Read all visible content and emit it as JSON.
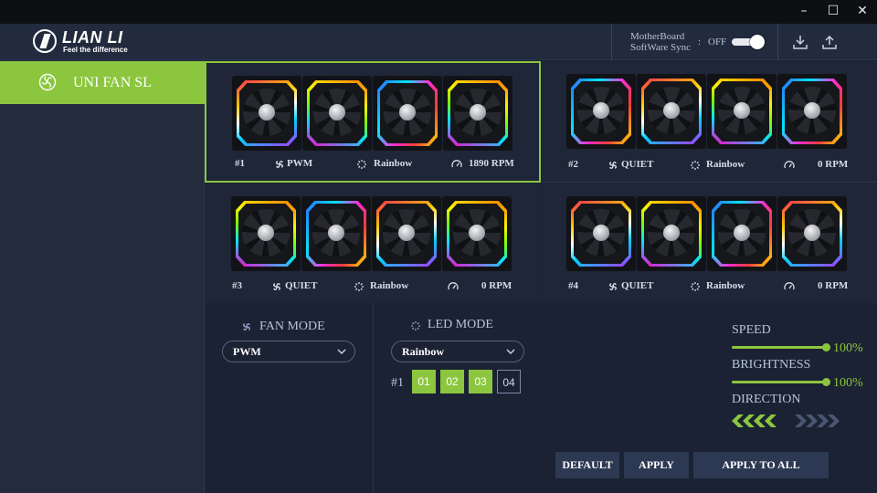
{
  "window": {
    "minimize": "–",
    "maximize": "☐",
    "close": "✕"
  },
  "header": {
    "brand_name": "LIAN LI",
    "brand_tagline": "Feel the difference",
    "sync_label": "MotherBoard SoftWare Sync",
    "sync_colon": ":",
    "sync_state": "OFF"
  },
  "sidebar": {
    "items": [
      {
        "label": "UNI FAN SL",
        "active": true
      }
    ]
  },
  "groups": [
    {
      "index": "#1",
      "fan_mode": "PWM",
      "led_mode": "Rainbow",
      "speed": "1890 RPM",
      "selected": true
    },
    {
      "index": "#2",
      "fan_mode": "QUIET",
      "led_mode": "Rainbow",
      "speed": "0 RPM",
      "selected": false
    },
    {
      "index": "#3",
      "fan_mode": "QUIET",
      "led_mode": "Rainbow",
      "speed": "0 RPM",
      "selected": false
    },
    {
      "index": "#4",
      "fan_mode": "QUIET",
      "led_mode": "Rainbow",
      "speed": "0 RPM",
      "selected": false
    }
  ],
  "fan_mode": {
    "title": "FAN MODE",
    "selected": "PWM"
  },
  "led_mode": {
    "title": "LED MODE",
    "selected": "Rainbow",
    "group_index": "#1",
    "fans": [
      {
        "label": "01",
        "on": true
      },
      {
        "label": "02",
        "on": true
      },
      {
        "label": "03",
        "on": true
      },
      {
        "label": "04",
        "on": false
      }
    ]
  },
  "speed": {
    "label": "SPEED",
    "value_text": "100%",
    "value": 1.0
  },
  "brightness": {
    "label": "BRIGHTNESS",
    "value_text": "100%",
    "value": 1.0
  },
  "direction": {
    "label": "DIRECTION",
    "selected": "left"
  },
  "buttons": {
    "default": "DEFAULT",
    "apply": "APPLY",
    "apply_all": "APPLY TO ALL"
  },
  "colors": {
    "accent": "#8cc63f",
    "background": "#1b2233",
    "panel": "#1e2637",
    "button": "#2d3852"
  }
}
